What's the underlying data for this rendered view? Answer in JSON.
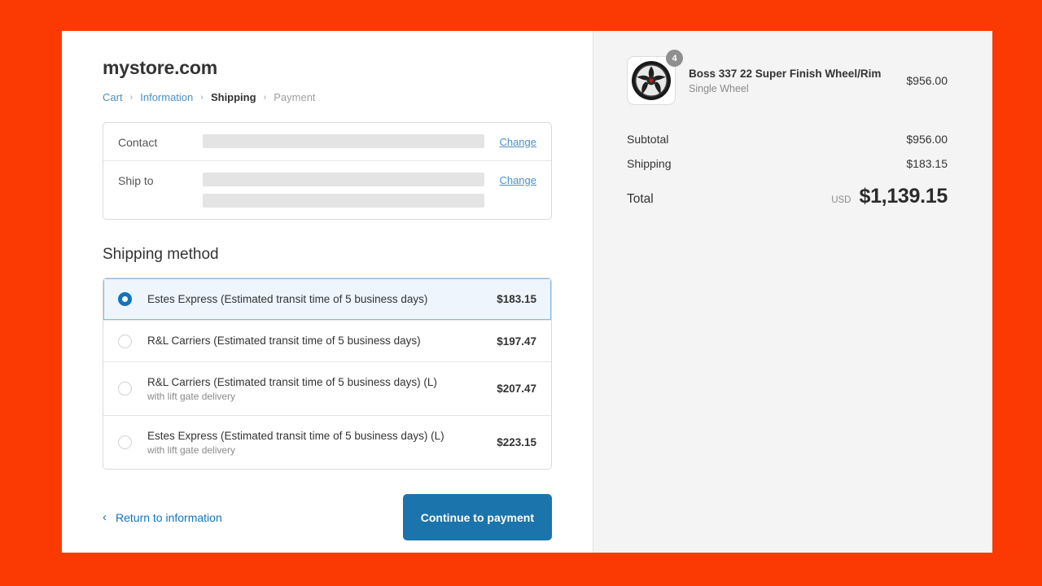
{
  "store": {
    "name": "mystore.com"
  },
  "breadcrumb": {
    "items": [
      {
        "label": "Cart",
        "state": "link"
      },
      {
        "label": "Information",
        "state": "link"
      },
      {
        "label": "Shipping",
        "state": "current"
      },
      {
        "label": "Payment",
        "state": "upcoming"
      }
    ],
    "separator": "›"
  },
  "contact_card": {
    "rows": [
      {
        "label": "Contact",
        "value_redacted": true,
        "redacted_lines": 1,
        "change_label": "Change"
      },
      {
        "label": "Ship to",
        "value_redacted": true,
        "redacted_lines": 2,
        "change_label": "Change"
      }
    ]
  },
  "shipping": {
    "heading": "Shipping method",
    "options": [
      {
        "label": "Estes Express (Estimated transit time of 5 business days)",
        "sublabel": "",
        "price": "$183.15",
        "selected": true
      },
      {
        "label": "R&L Carriers (Estimated transit time of 5 business days)",
        "sublabel": "",
        "price": "$197.47",
        "selected": false
      },
      {
        "label": "R&L Carriers (Estimated transit time of 5 business days) (L)",
        "sublabel": "with lift gate delivery",
        "price": "$207.47",
        "selected": false
      },
      {
        "label": "Estes Express (Estimated transit time of 5 business days) (L)",
        "sublabel": "with lift gate delivery",
        "price": "$223.15",
        "selected": false
      }
    ]
  },
  "footer": {
    "return_label": "Return to information",
    "return_chevron": "‹",
    "continue_label": "Continue to payment"
  },
  "summary": {
    "item": {
      "title": "Boss 337 22 Super Finish Wheel/Rim",
      "variant": "Single Wheel",
      "price": "$956.00",
      "quantity": "4",
      "image_alt": "car-wheel-rim-photo"
    },
    "totals": [
      {
        "label": "Subtotal",
        "value": "$956.00"
      },
      {
        "label": "Shipping",
        "value": "$183.15"
      }
    ],
    "grand_total": {
      "label": "Total",
      "currency": "USD",
      "value": "$1,139.15"
    }
  },
  "colors": {
    "backdrop": "#fa3a02",
    "accent_button": "#1b74ab",
    "link": "#4a90c4",
    "selected_row_bg": "#eef5fc",
    "selected_row_border": "#8cb8dd",
    "summary_bg": "#f4f4f4"
  }
}
